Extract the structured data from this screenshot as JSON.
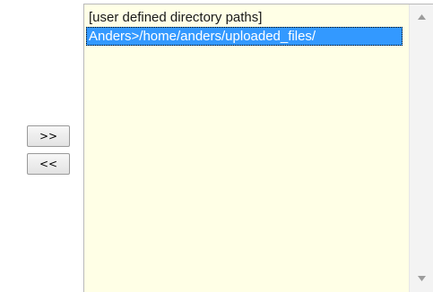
{
  "buttons": {
    "add_label": ">>",
    "remove_label": "<<"
  },
  "directory_list": {
    "items": [
      {
        "label": "[user defined directory paths]",
        "selected": false
      },
      {
        "label": "Anders>/home/anders/uploaded_files/",
        "selected": true
      }
    ]
  },
  "icons": {
    "scroll_up": "triangle-up-icon",
    "scroll_down": "triangle-down-icon"
  },
  "colors": {
    "list_background": "#ffffe6",
    "selection": "#3399ff"
  }
}
